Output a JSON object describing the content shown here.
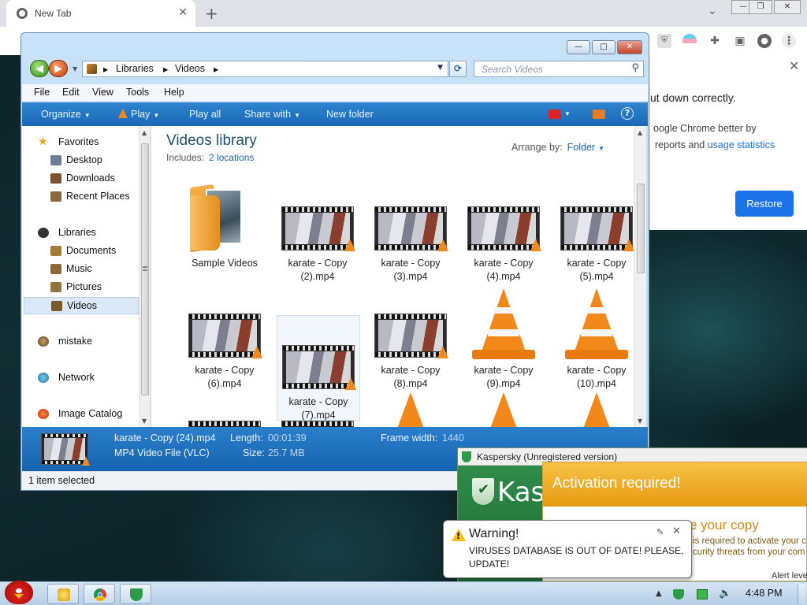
{
  "chrome": {
    "tab_title": "New Tab",
    "tab_close": "✕",
    "new_tab": "+",
    "tab_list": "⌄",
    "win_minimize": "—",
    "win_maximize": "❐",
    "win_close": "✕",
    "toolbar_icons": [
      "ublock-icon",
      "flag-icon",
      "extensions-icon",
      "sidepanel-icon",
      "profile-icon",
      "menu-icon"
    ],
    "restore_msg": "ut down correctly.",
    "improve_line1": "oogle Chrome better by",
    "improve_line2_text": "reports and",
    "improve_line2_link": "usage statistics",
    "restore_button": "Restore",
    "close_x": "✕"
  },
  "explorer": {
    "address_segments": [
      "Libraries",
      "Videos"
    ],
    "search_placeholder": "Search Videos",
    "menu": [
      "File",
      "Edit",
      "View",
      "Tools",
      "Help"
    ],
    "commands": {
      "organize": "Organize",
      "play": "Play",
      "play_all": "Play all",
      "share_with": "Share with",
      "new_folder": "New folder"
    },
    "nav": {
      "favorites": "Favorites",
      "desktop": "Desktop",
      "downloads": "Downloads",
      "recent_places": "Recent Places",
      "libraries": "Libraries",
      "documents": "Documents",
      "music": "Music",
      "pictures": "Pictures",
      "videos": "Videos",
      "mistake": "mistake",
      "network": "Network",
      "image_catalog": "Image Catalog"
    },
    "library_title": "Videos library",
    "includes_label": "Includes:",
    "includes_link": "2 locations",
    "arrange_label": "Arrange by:",
    "arrange_value": "Folder",
    "items": [
      {
        "name": "Sample Videos",
        "kind": "folder"
      },
      {
        "name": "karate - Copy (2).mp4",
        "l1": "karate - Copy",
        "l2": "(2).mp4",
        "kind": "video"
      },
      {
        "name": "karate - Copy (3).mp4",
        "l1": "karate - Copy",
        "l2": "(3).mp4",
        "kind": "video"
      },
      {
        "name": "karate - Copy (4).mp4",
        "l1": "karate - Copy",
        "l2": "(4).mp4",
        "kind": "video"
      },
      {
        "name": "karate - Copy (5).mp4",
        "l1": "karate - Copy",
        "l2": "(5).mp4",
        "kind": "video"
      },
      {
        "name": "karate - Copy (6).mp4",
        "l1": "karate - Copy",
        "l2": "(6).mp4",
        "kind": "video"
      },
      {
        "name": "karate - Copy (7).mp4",
        "l1": "karate - Copy",
        "l2": "(7).mp4",
        "kind": "video"
      },
      {
        "name": "karate - Copy (8).mp4",
        "l1": "karate - Copy",
        "l2": "(8).mp4",
        "kind": "video"
      },
      {
        "name": "karate - Copy (9).mp4",
        "l1": "karate - Copy",
        "l2": "(9).mp4",
        "kind": "vlc"
      },
      {
        "name": "karate - Copy (10).mp4",
        "l1": "karate - Copy",
        "l2": "(10).mp4",
        "kind": "vlc"
      }
    ],
    "details": {
      "filename": "karate - Copy (24).mp4",
      "filetype": "MP4 Video File (VLC)",
      "length_label": "Length:",
      "length_value": "00:01:39",
      "size_label": "Size:",
      "size_value": "25.7 MB",
      "frame_width_label": "Frame width:",
      "frame_width_value": "1440"
    },
    "status": "1 item selected"
  },
  "kaspersky": {
    "title": "Kaspersky (Unregistered version)",
    "brand": "Kas",
    "activation_title": "Activation required!",
    "activation_sub": "e your copy",
    "activation_line1": "is required to activate your c",
    "activation_line2": "curity threats from your com",
    "alert_level": "Alert leve"
  },
  "balloon": {
    "title": "Warning!",
    "message": "VIRUSES DATABASE IS OUT OF DATE! PLEASE, UPDATE!"
  },
  "taskbar": {
    "clock": "4:48 PM"
  },
  "colors": {
    "explorer_cmdbar": "#1a68b6",
    "chrome_blue": "#1a73e8",
    "kaspersky_green": "#1f6b3a",
    "activation_orange": "#e59a12"
  }
}
